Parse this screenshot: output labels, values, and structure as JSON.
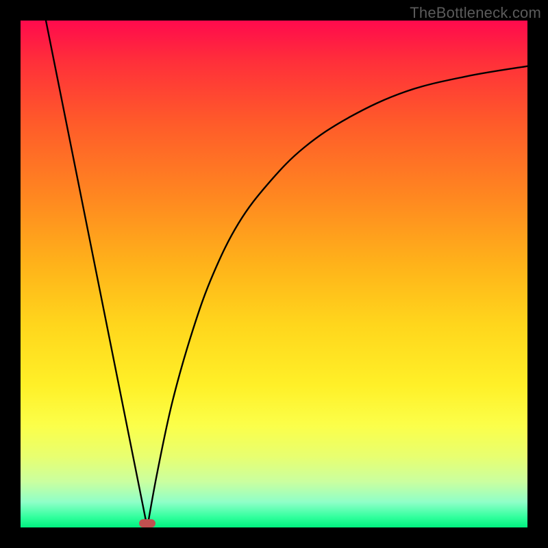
{
  "watermark": "TheBottleneck.com",
  "marker": {
    "x_frac": 0.25,
    "y_frac": 0.992
  },
  "chart_data": {
    "type": "line",
    "title": "",
    "xlabel": "",
    "ylabel": "",
    "xlim": [
      0,
      100
    ],
    "ylim": [
      0,
      100
    ],
    "series": [
      {
        "name": "left-branch",
        "x": [
          5,
          10,
          15,
          20,
          25
        ],
        "y": [
          100,
          75,
          50,
          25,
          0
        ]
      },
      {
        "name": "right-branch",
        "x": [
          25,
          27,
          30,
          34,
          38,
          43,
          49,
          56,
          65,
          76,
          88,
          100
        ],
        "y": [
          0,
          11,
          25,
          39,
          50,
          60,
          68,
          75,
          81,
          86,
          89,
          91
        ]
      }
    ],
    "annotations": [
      {
        "name": "minimum-marker",
        "x": 25,
        "y": 0
      }
    ],
    "background_gradient": {
      "top": "#ff0a4d",
      "middle": "#ffd61c",
      "bottom": "#00f07f"
    }
  }
}
